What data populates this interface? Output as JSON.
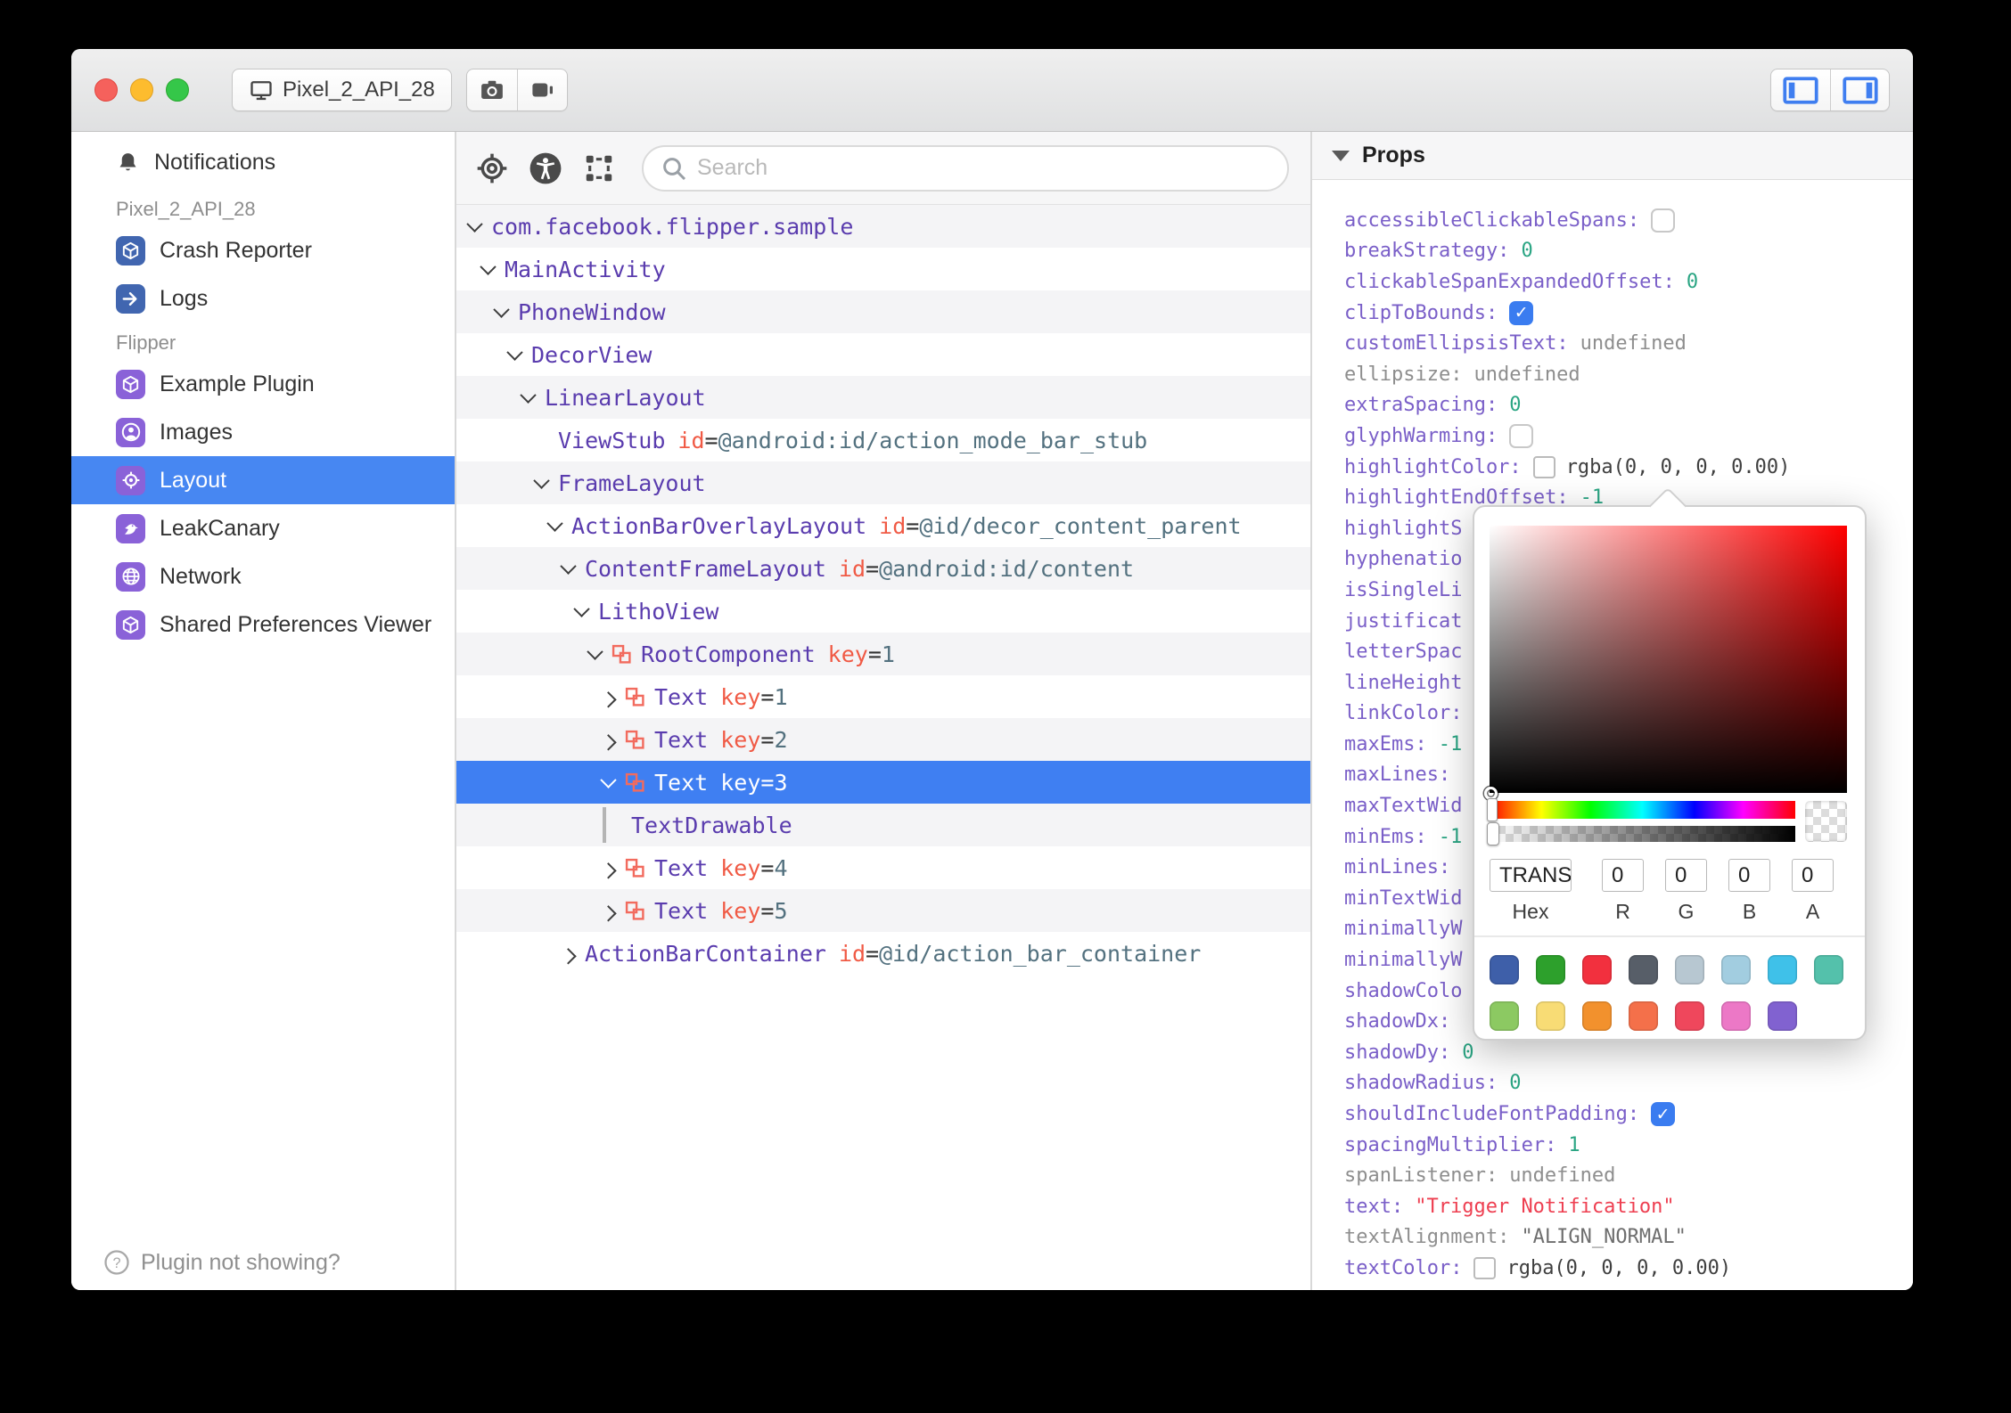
{
  "titlebar": {
    "device_label": "Pixel_2_API_28"
  },
  "sidebar": {
    "items": [
      {
        "type": "notif",
        "icon": "bell-icon",
        "label": "Notifications"
      },
      {
        "type": "header",
        "label": "Pixel_2_API_28"
      },
      {
        "type": "item",
        "icon": "cube-icon",
        "icon_bg": "#4166b0",
        "label": "Crash Reporter"
      },
      {
        "type": "item",
        "icon": "arrow-right-icon",
        "icon_bg": "#4166b0",
        "label": "Logs"
      },
      {
        "type": "header",
        "label": "Flipper"
      },
      {
        "type": "item",
        "icon": "cube-icon",
        "icon_bg": "#8a62d8",
        "label": "Example Plugin"
      },
      {
        "type": "item",
        "icon": "person-icon",
        "icon_bg": "#8a62d8",
        "label": "Images"
      },
      {
        "type": "item",
        "icon": "target-icon",
        "icon_bg": "#8a62d8",
        "label": "Layout",
        "selected": true
      },
      {
        "type": "item",
        "icon": "bird-icon",
        "icon_bg": "#8a62d8",
        "label": "LeakCanary"
      },
      {
        "type": "item",
        "icon": "globe-icon",
        "icon_bg": "#8a62d8",
        "label": "Network"
      },
      {
        "type": "item",
        "icon": "cube-icon",
        "icon_bg": "#8a62d8",
        "label": "Shared Preferences Viewer"
      }
    ],
    "footer": "Plugin not showing?"
  },
  "toolbar": {
    "search_placeholder": "Search"
  },
  "tree": {
    "rows": [
      {
        "level": 0,
        "chev": "open",
        "name": "com.facebook.flipper.sample"
      },
      {
        "level": 1,
        "chev": "open",
        "name": "MainActivity"
      },
      {
        "level": 2,
        "chev": "open",
        "name": "PhoneWindow"
      },
      {
        "level": 3,
        "chev": "open",
        "name": "DecorView"
      },
      {
        "level": 4,
        "chev": "open",
        "name": "LinearLayout"
      },
      {
        "level": 5,
        "chev": "none",
        "name": "ViewStub",
        "attrs": [
          {
            "k": "id",
            "v": "@android:id/action_mode_bar_stub"
          }
        ]
      },
      {
        "level": 5,
        "chev": "open",
        "name": "FrameLayout"
      },
      {
        "level": 6,
        "chev": "open",
        "name": "ActionBarOverlayLayout",
        "attrs": [
          {
            "k": "id",
            "v": "@id/decor_content_parent"
          }
        ]
      },
      {
        "level": 7,
        "chev": "open",
        "name": "ContentFrameLayout",
        "attrs": [
          {
            "k": "id",
            "v": "@android:id/content"
          }
        ]
      },
      {
        "level": 8,
        "chev": "open",
        "name": "LithoView"
      },
      {
        "level": 9,
        "chev": "open",
        "litho": true,
        "name": "RootComponent",
        "attrs": [
          {
            "k": "key",
            "v": "1"
          }
        ]
      },
      {
        "level": 10,
        "chev": "closed",
        "litho": true,
        "name": "Text",
        "attrs": [
          {
            "k": "key",
            "v": "1"
          }
        ]
      },
      {
        "level": 10,
        "chev": "closed",
        "litho": true,
        "name": "Text",
        "attrs": [
          {
            "k": "key",
            "v": "2"
          }
        ]
      },
      {
        "level": 10,
        "chev": "open",
        "litho": true,
        "name": "Text",
        "attrs": [
          {
            "k": "key",
            "v": "3"
          }
        ],
        "selected": true
      },
      {
        "level": 10,
        "chev": "guide",
        "name": "TextDrawable"
      },
      {
        "level": 10,
        "chev": "closed",
        "litho": true,
        "name": "Text",
        "attrs": [
          {
            "k": "key",
            "v": "4"
          }
        ]
      },
      {
        "level": 10,
        "chev": "closed",
        "litho": true,
        "name": "Text",
        "attrs": [
          {
            "k": "key",
            "v": "5"
          }
        ]
      },
      {
        "level": 7,
        "chev": "closed",
        "name": "ActionBarContainer",
        "attrs": [
          {
            "k": "id",
            "v": "@id/action_bar_container"
          }
        ]
      }
    ]
  },
  "props": {
    "header": "Props",
    "rows": [
      {
        "key": "accessibleClickableSpans",
        "type": "cb-off"
      },
      {
        "key": "breakStrategy",
        "type": "num",
        "value": "0"
      },
      {
        "key": "clickableSpanExpandedOffset",
        "type": "num",
        "value": "0"
      },
      {
        "key": "clipToBounds",
        "type": "cb-on"
      },
      {
        "key": "customEllipsisText",
        "type": "undef",
        "value": "undefined"
      },
      {
        "key": "ellipsize",
        "type": "undef",
        "value": "undefined",
        "gray_key": true
      },
      {
        "key": "extraSpacing",
        "type": "num",
        "value": "0"
      },
      {
        "key": "glyphWarming",
        "type": "cb-off"
      },
      {
        "key": "highlightColor",
        "type": "color",
        "value": "rgba(0, 0, 0, 0.00)"
      },
      {
        "key": "highlightEndOffset",
        "type": "num",
        "value": "-1"
      },
      {
        "key": "highlightS",
        "type": "trunc"
      },
      {
        "key": "hyphenatio",
        "type": "trunc"
      },
      {
        "key": "isSingleLi",
        "type": "trunc"
      },
      {
        "key": "justificat",
        "type": "trunc"
      },
      {
        "key": "letterSpac",
        "type": "trunc"
      },
      {
        "key": "lineHeight",
        "type": "trunc"
      },
      {
        "key": "linkColor",
        "type": "bare"
      },
      {
        "key": "maxEms",
        "type": "num",
        "value": "-1"
      },
      {
        "key": "maxLines",
        "type": "bare"
      },
      {
        "key": "maxTextWid",
        "type": "trunc"
      },
      {
        "key": "minEms",
        "type": "num",
        "value": "-1"
      },
      {
        "key": "minLines",
        "type": "bare"
      },
      {
        "key": "minTextWid",
        "type": "trunc"
      },
      {
        "key": "minimallyW",
        "type": "trunc"
      },
      {
        "key": "minimallyW",
        "type": "trunc"
      },
      {
        "key": "shadowColo",
        "type": "trunc"
      },
      {
        "key": "shadowDx",
        "type": "bare"
      },
      {
        "key": "shadowDy",
        "type": "num",
        "value": "0"
      },
      {
        "key": "shadowRadius",
        "type": "num",
        "value": "0"
      },
      {
        "key": "shouldIncludeFontPadding",
        "type": "cb-on"
      },
      {
        "key": "spacingMultiplier",
        "type": "num",
        "value": "1"
      },
      {
        "key": "spanListener",
        "type": "undef",
        "value": "undefined",
        "gray_key": true
      },
      {
        "key": "text",
        "type": "str",
        "value": "\"Trigger Notification\""
      },
      {
        "key": "textAlignment",
        "type": "gstr",
        "value": "\"ALIGN_NORMAL\"",
        "gray_key": true
      },
      {
        "key": "textColor",
        "type": "color",
        "value": "rgba(0, 0, 0, 0.00)"
      }
    ]
  },
  "picker": {
    "hex": "TRANS",
    "r": "0",
    "g": "0",
    "b": "0",
    "a": "0",
    "labels": [
      "Hex",
      "R",
      "G",
      "B",
      "A"
    ],
    "swatches_row1": [
      "#3e5fa9",
      "#2da02c",
      "#f2303e",
      "#575e68",
      "#b7c7d1",
      "#a2cde0",
      "#3fc1e9",
      "#54c1ab"
    ],
    "swatches_row2": [
      "#8cc962",
      "#f8dc75",
      "#f2912d",
      "#f4704a",
      "#ef475c",
      "#ec78c6",
      "#8162d0"
    ]
  },
  "colors": {
    "accent_blue": "#3f7ff2",
    "sidebar_selected": "#4787f2",
    "tree_name": "#5a3cae",
    "attr_key": "#f05a45",
    "attr_value": "#53717f",
    "prop_key": "#7a5fc8",
    "number_value": "#2aa583",
    "string_value": "#ee3f51",
    "litho_icon": "#f26b5e"
  }
}
